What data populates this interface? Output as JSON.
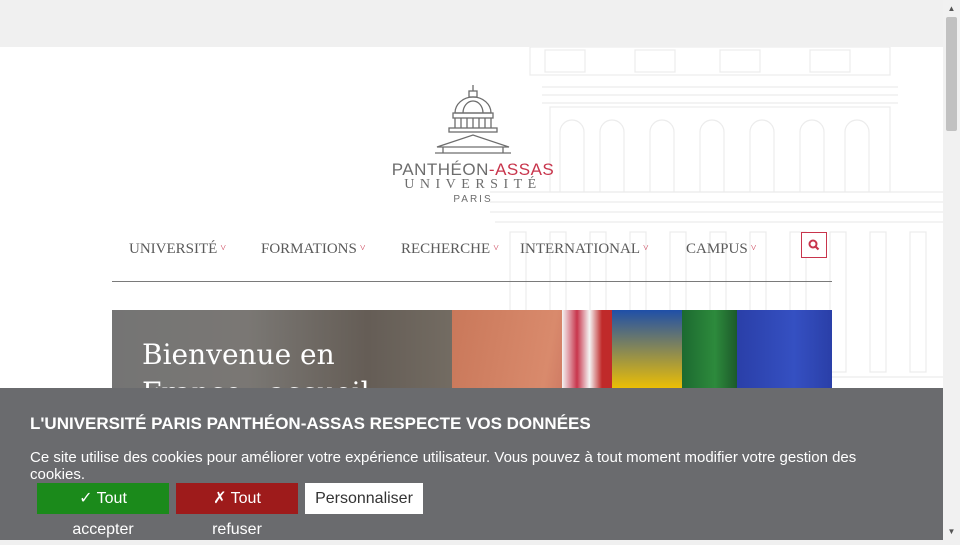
{
  "logo": {
    "line1_main": "PANTHÉON",
    "line1_sep": "-",
    "line1_accent": "ASSAS",
    "line2": "UNIVERSITÉ",
    "line3": "PARIS"
  },
  "nav": {
    "items": [
      {
        "label": "UNIVERSITÉ"
      },
      {
        "label": "FORMATIONS"
      },
      {
        "label": "RECHERCHE"
      },
      {
        "label": "INTERNATIONAL"
      },
      {
        "label": "CAMPUS"
      }
    ],
    "chevron": "˅",
    "search_icon": "search-icon"
  },
  "hero": {
    "title": "Bienvenue en France : accueil"
  },
  "cookie": {
    "title": "L'UNIVERSITÉ PARIS PANTHÉON-ASSAS RESPECTE VOS DONNÉES",
    "text": "Ce site utilise des cookies pour améliorer votre expérience utilisateur. Vous pouvez à tout moment modifier votre gestion des cookies.",
    "accept_label": "✓ Tout accepter",
    "refuse_label": "✗ Tout refuser",
    "customize_label": "Personnaliser"
  },
  "colors": {
    "accent": "#c8354c",
    "cookie_bg": "#6a6b6e",
    "accept_bg": "#1b8a1b",
    "refuse_bg": "#9e1b1b"
  }
}
